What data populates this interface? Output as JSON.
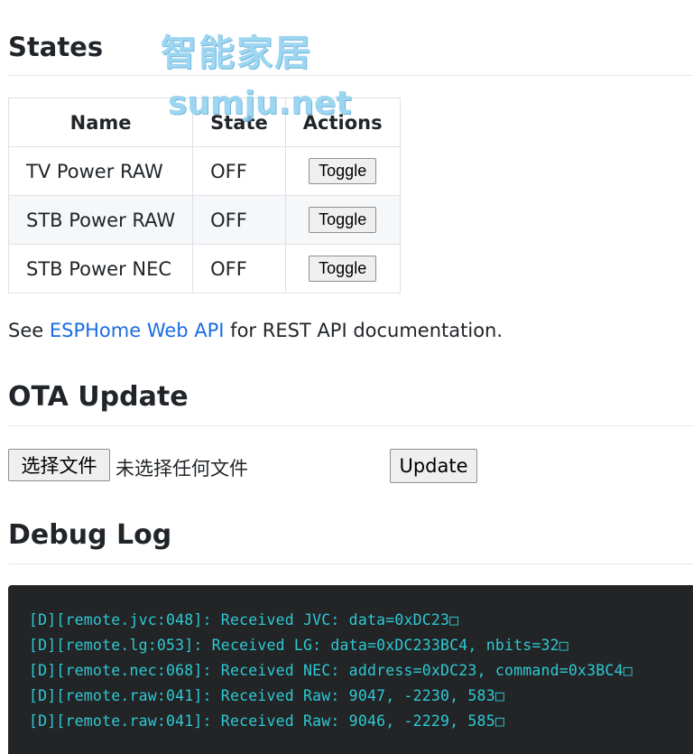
{
  "states": {
    "title": "States",
    "columns": [
      "Name",
      "State",
      "Actions"
    ],
    "rows": [
      {
        "name": "TV Power RAW",
        "state": "OFF",
        "action": "Toggle"
      },
      {
        "name": "STB Power RAW",
        "state": "OFF",
        "action": "Toggle"
      },
      {
        "name": "STB Power NEC",
        "state": "OFF",
        "action": "Toggle"
      }
    ],
    "api_prefix": "See ",
    "api_link": "ESPHome Web API",
    "api_suffix": " for REST API documentation."
  },
  "ota": {
    "title": "OTA Update",
    "choose_file_label": "选择文件",
    "file_status": "未选择任何文件",
    "update_label": "Update"
  },
  "debug": {
    "title": "Debug Log",
    "lines": [
      "[D][remote.jvc:048]: Received JVC: data=0xDC23□",
      "[D][remote.lg:053]: Received LG: data=0xDC233BC4, nbits=32□",
      "[D][remote.nec:068]: Received NEC: address=0xDC23, command=0x3BC4□",
      "[D][remote.raw:041]: Received Raw: 9047, -2230, 583□",
      "[D][remote.raw:041]: Received Raw: 9046, -2229, 585□"
    ]
  },
  "watermark": {
    "text_cn": "智能家居",
    "text_en": "sumju.net"
  }
}
